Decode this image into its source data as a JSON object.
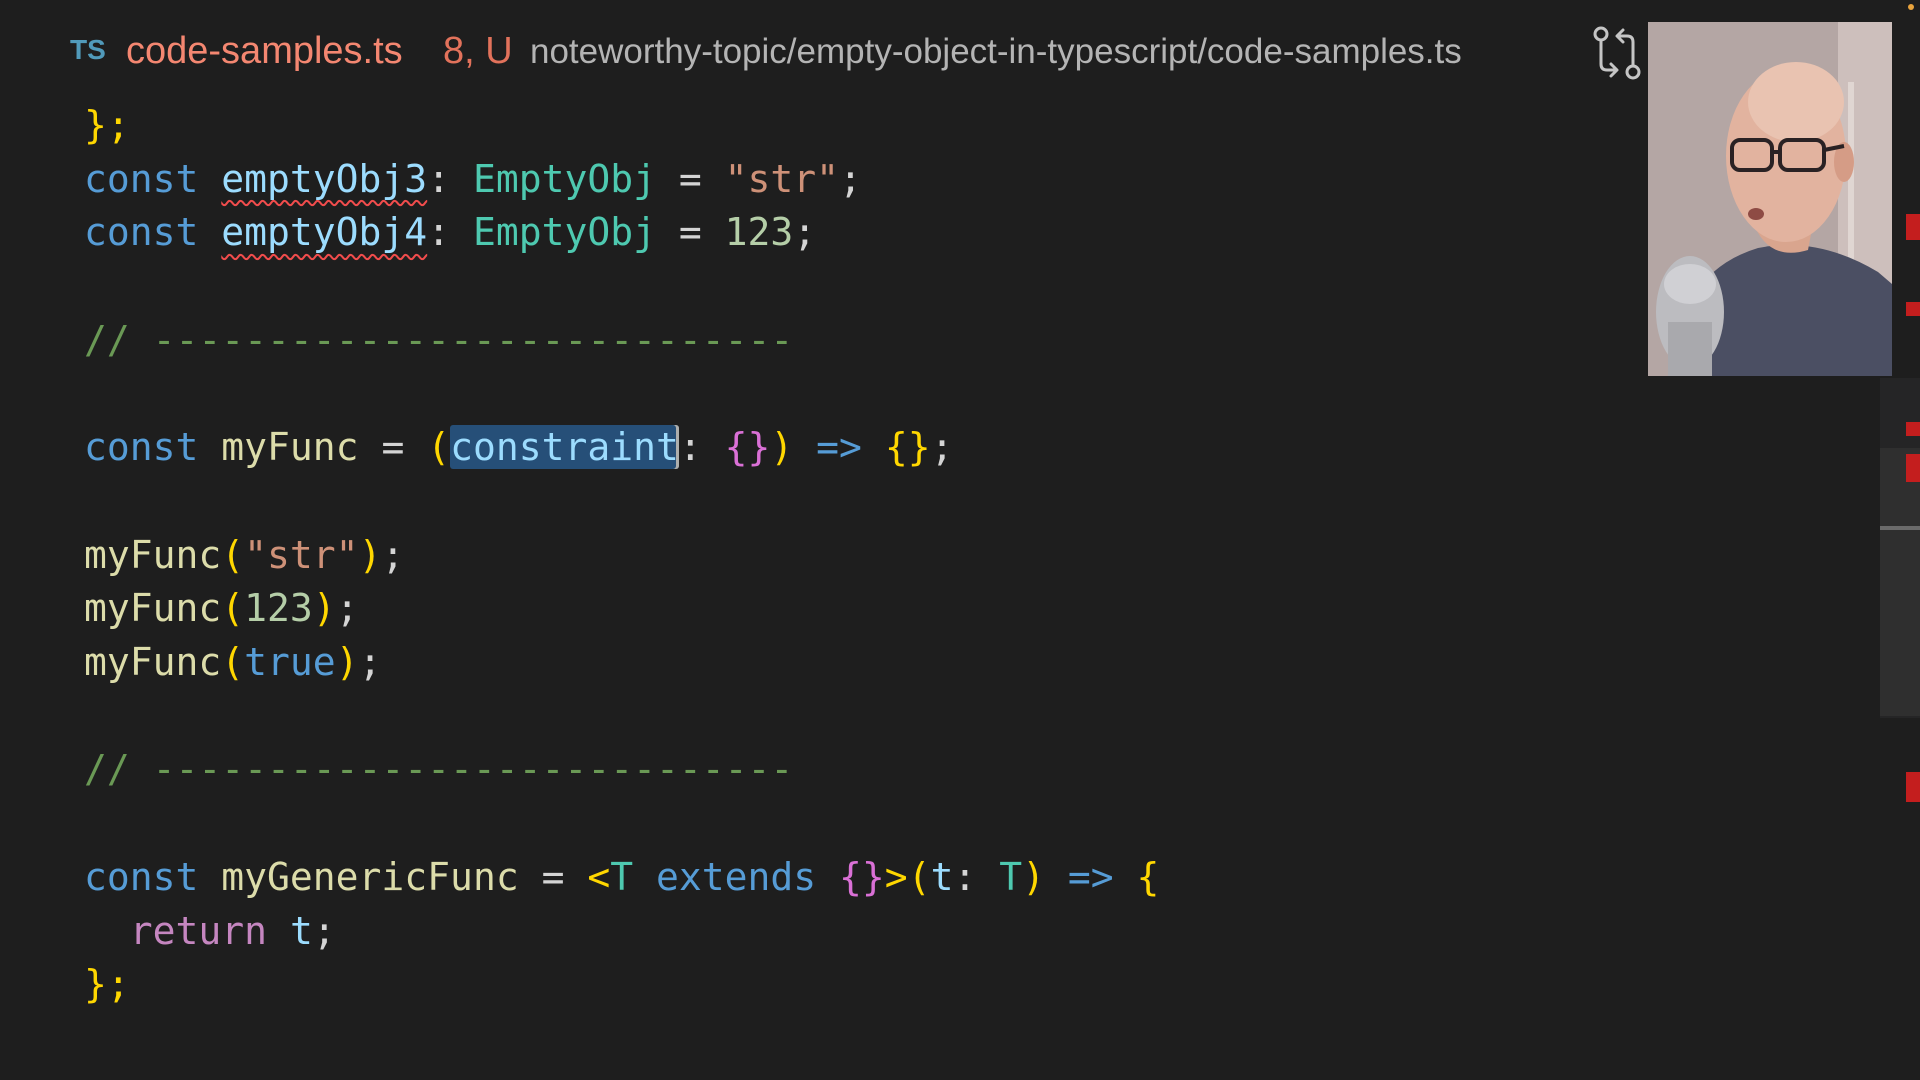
{
  "title_bar": {
    "language_badge": "TS",
    "file_name": "code-samples.ts",
    "status": "8, U",
    "relative_path": "noteworthy-topic/empty-object-in-typescript/code-samples.ts",
    "compare_icon": "git-compare-icon"
  },
  "colors": {
    "background": "#1e1e1e",
    "keyword": "#569cd6",
    "control_keyword": "#c586c0",
    "variable": "#9cdcfe",
    "function": "#dcdcaa",
    "type": "#4ec9b0",
    "string": "#ce9178",
    "number": "#b5cea8",
    "comment": "#6a9955",
    "error": "#f14c4c",
    "selection": "#264f78"
  },
  "editor": {
    "lines": [
      [
        {
          "t": "};",
          "c": "b1"
        }
      ],
      [
        {
          "t": "const ",
          "c": "kw"
        },
        {
          "t": "emptyObj3",
          "c": "var",
          "err": true
        },
        {
          "t": ": ",
          "c": "pnc"
        },
        {
          "t": "EmptyObj",
          "c": "typ"
        },
        {
          "t": " = ",
          "c": "pnc"
        },
        {
          "t": "\"str\"",
          "c": "str"
        },
        {
          "t": ";",
          "c": "pnc"
        }
      ],
      [
        {
          "t": "const ",
          "c": "kw"
        },
        {
          "t": "emptyObj4",
          "c": "var",
          "err": true
        },
        {
          "t": ": ",
          "c": "pnc"
        },
        {
          "t": "EmptyObj",
          "c": "typ"
        },
        {
          "t": " = ",
          "c": "pnc"
        },
        {
          "t": "123",
          "c": "num"
        },
        {
          "t": ";",
          "c": "pnc"
        }
      ],
      [],
      [
        {
          "t": "// ----------------------------",
          "c": "cmt"
        }
      ],
      [],
      [
        {
          "t": "const ",
          "c": "kw"
        },
        {
          "t": "myFunc",
          "c": "fn"
        },
        {
          "t": " = ",
          "c": "pnc"
        },
        {
          "t": "(",
          "c": "b1"
        },
        {
          "t": "constraint",
          "c": "var",
          "sel": true
        },
        {
          "t": ": ",
          "c": "pnc"
        },
        {
          "t": "{}",
          "c": "b2"
        },
        {
          "t": ")",
          "c": "b1"
        },
        {
          "t": " => ",
          "c": "kw"
        },
        {
          "t": "{}",
          "c": "b1"
        },
        {
          "t": ";",
          "c": "pnc"
        }
      ],
      [],
      [
        {
          "t": "myFunc",
          "c": "fn"
        },
        {
          "t": "(",
          "c": "b1"
        },
        {
          "t": "\"str\"",
          "c": "str"
        },
        {
          "t": ")",
          "c": "b1"
        },
        {
          "t": ";",
          "c": "pnc"
        }
      ],
      [
        {
          "t": "myFunc",
          "c": "fn"
        },
        {
          "t": "(",
          "c": "b1"
        },
        {
          "t": "123",
          "c": "num"
        },
        {
          "t": ")",
          "c": "b1"
        },
        {
          "t": ";",
          "c": "pnc"
        }
      ],
      [
        {
          "t": "myFunc",
          "c": "fn"
        },
        {
          "t": "(",
          "c": "b1"
        },
        {
          "t": "true",
          "c": "kw"
        },
        {
          "t": ")",
          "c": "b1"
        },
        {
          "t": ";",
          "c": "pnc"
        }
      ],
      [],
      [
        {
          "t": "// ----------------------------",
          "c": "cmt"
        }
      ],
      [],
      [
        {
          "t": "const ",
          "c": "kw"
        },
        {
          "t": "myGenericFunc",
          "c": "fn"
        },
        {
          "t": " = ",
          "c": "pnc"
        },
        {
          "t": "<",
          "c": "b1"
        },
        {
          "t": "T",
          "c": "typ"
        },
        {
          "t": " extends ",
          "c": "kw"
        },
        {
          "t": "{}",
          "c": "b2"
        },
        {
          "t": ">",
          "c": "b1"
        },
        {
          "t": "(",
          "c": "b1"
        },
        {
          "t": "t",
          "c": "var"
        },
        {
          "t": ": ",
          "c": "pnc"
        },
        {
          "t": "T",
          "c": "typ"
        },
        {
          "t": ")",
          "c": "b1"
        },
        {
          "t": " => ",
          "c": "kw"
        },
        {
          "t": "{",
          "c": "b1"
        }
      ],
      [
        {
          "t": "  ",
          "c": "pnc"
        },
        {
          "t": "return",
          "c": "kwc"
        },
        {
          "t": " ",
          "c": "pnc"
        },
        {
          "t": "t",
          "c": "var"
        },
        {
          "t": ";",
          "c": "pnc"
        }
      ],
      [
        {
          "t": "};",
          "c": "b1"
        }
      ]
    ]
  },
  "webcam": {
    "icon": "presenter-video-icon"
  }
}
